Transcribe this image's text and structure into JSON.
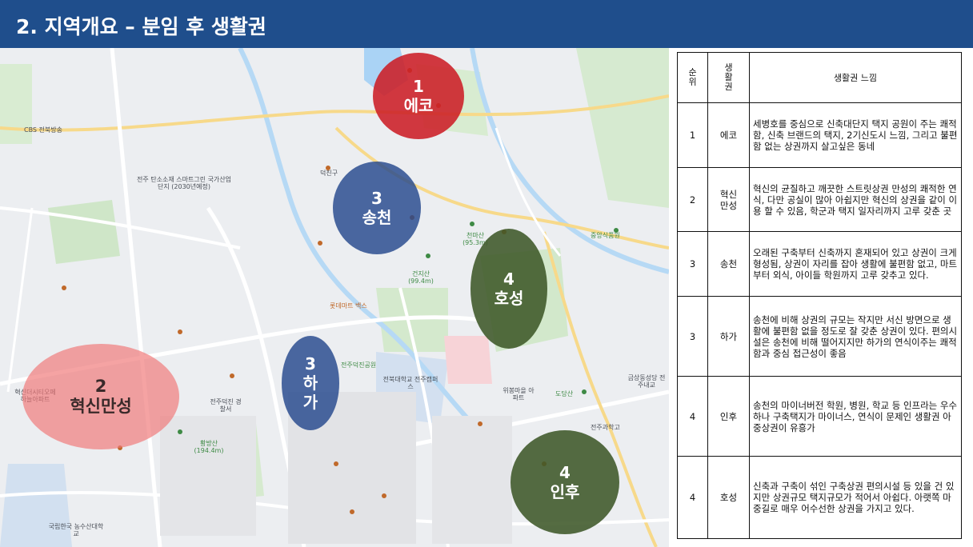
{
  "header": {
    "title": "2. 지역개요 – 분임 후 생활권"
  },
  "colors": {
    "header_bg": "#1f4e8c",
    "eco": "#cc1e26",
    "blue_zone": "#24488c",
    "green_zone": "#3e5828",
    "pink_zone": "#f07878"
  },
  "zones": {
    "eco": {
      "num": "1",
      "name": "에코"
    },
    "hyeoksin": {
      "num": "2",
      "name": "혁신만성"
    },
    "songcheon": {
      "num": "3",
      "name": "송천"
    },
    "haga": {
      "num": "3",
      "line1": "하",
      "line2": "가"
    },
    "hoseong": {
      "num": "4",
      "name": "호성"
    },
    "inhu": {
      "num": "4",
      "name": "인후"
    }
  },
  "map_labels": {
    "cbs": "CBS 전북방송",
    "tech": "전주 탄소소재 스마트그린 국가산업단지 (2030년예정)",
    "deokjin": "덕진구",
    "lotte": "롯데마트 백스",
    "deokjin_park": "전주덕진공원",
    "hanbyeok": "한벽로",
    "jeonbuk_univ": "전북대학교 전주캠퍼스",
    "cheonmasan": "천마산 (95.3m)",
    "geonjisan": "건지산 (99.4m)",
    "hwangbangsan": "황방산 (194.4m)",
    "jungang": "중앙식품원",
    "deokjin_police": "전주덕진 경찰서",
    "dodangsan": "도당산",
    "geumsang": "금상동성당 전주내교",
    "hyeoksin_apt": "혁신더시티오페 하늘아파트",
    "nongsusan": "국립한국 농수산대학교",
    "science_high": "전주과학고",
    "wibong": "위봉마을 아파트"
  },
  "table": {
    "headers": {
      "rank": "순위",
      "zone": "생활권",
      "feel": "생활권 느낌"
    },
    "rows": [
      {
        "rank": "1",
        "zone": "에코",
        "desc": "세병호를 중심으로 신축대단지 택지 공원이 주는 쾌적함, 신축 브랜드의 택지, 2기신도시 느낌, 그리고 불편함 없는 상권까지 살고싶은 동네"
      },
      {
        "rank": "2",
        "zone": "혁신만성",
        "desc": "혁신의 균질하고 깨끗한 스트릿상권 만성의 쾌적한 연식, 다만 공실이 많아 아쉽지만 혁신의 상권을 같이 이용 할 수 있음, 학군과 택지 일자리까지 고루 갖춘 곳"
      },
      {
        "rank": "3",
        "zone": "송천",
        "desc": "오래된 구축부터 신축까지 혼재되어 있고 상권이 크게 형성됨, 상권이 자리를 잡아 생활에 불편함 없고, 마트부터 외식, 아이들 학원까지 고루 갖추고 있다."
      },
      {
        "rank": "3",
        "zone": "하가",
        "desc": "송천에 비해 상권의 규모는 작지만 서신 방면으로 생활에 불편함 없을 정도로 잘 갖춘 상권이 있다. 편의시설은 송천에 비해 떨어지지만 하가의 연식이주는 쾌적함과 중심 접근성이 좋음"
      },
      {
        "rank": "4",
        "zone": "인후",
        "desc": "송천의 마이너버전 학원, 병원, 학교 등 인프라는 우수하나 구축택지가 마이너스, 연식이 문제인 생활권 아중상권이 유흥가"
      },
      {
        "rank": "4",
        "zone": "호성",
        "desc": "신축과 구축이 섞인 구축상권 편의시설 등 있을 건 있지만 상권규모 택지규모가 적어서 아쉽다. 아랫쪽 마중길로 매우 어수선한 상권을 가지고 있다."
      }
    ]
  }
}
